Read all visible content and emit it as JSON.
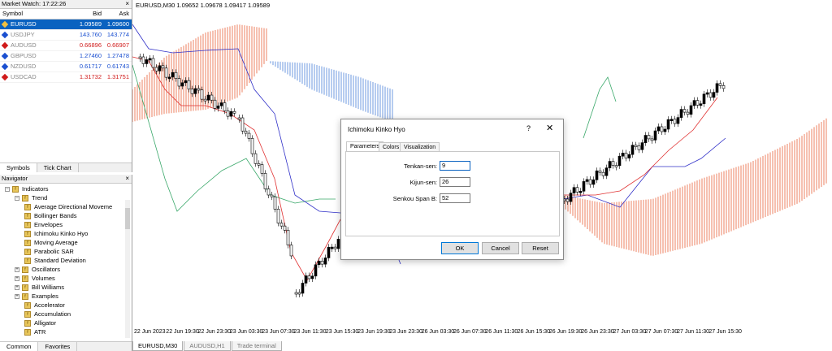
{
  "market_watch": {
    "title": "Market Watch: 17:22:26",
    "columns": {
      "symbol": "Symbol",
      "bid": "Bid",
      "ask": "Ask"
    },
    "rows": [
      {
        "symbol": "EURUSD",
        "bid": "1.09589",
        "ask": "1.09600",
        "color": "#ffffff",
        "selected": true
      },
      {
        "symbol": "USDJPY",
        "bid": "143.760",
        "ask": "143.774",
        "color": "#1a4fd0"
      },
      {
        "symbol": "AUDUSD",
        "bid": "0.66896",
        "ask": "0.66907",
        "color": "#d01a1a"
      },
      {
        "symbol": "GBPUSD",
        "bid": "1.27460",
        "ask": "1.27478",
        "color": "#1a4fd0"
      },
      {
        "symbol": "NZDUSD",
        "bid": "0.61717",
        "ask": "0.61743",
        "color": "#1a4fd0"
      },
      {
        "symbol": "USDCAD",
        "bid": "1.31732",
        "ask": "1.31751",
        "color": "#d01a1a"
      }
    ],
    "tabs": [
      "Symbols",
      "Tick Chart"
    ]
  },
  "navigator": {
    "title": "Navigator",
    "items": [
      {
        "label": "Indicators"
      },
      {
        "label": "Trend"
      },
      {
        "label": "Average Directional Moveme"
      },
      {
        "label": "Bollinger Bands"
      },
      {
        "label": "Envelopes"
      },
      {
        "label": "Ichimoku Kinko Hyo"
      },
      {
        "label": "Moving Average"
      },
      {
        "label": "Parabolic SAR"
      },
      {
        "label": "Standard Deviation"
      },
      {
        "label": "Oscillators"
      },
      {
        "label": "Volumes"
      },
      {
        "label": "Bill Williams"
      },
      {
        "label": "Examples"
      },
      {
        "label": "Accelerator"
      },
      {
        "label": "Accumulation"
      },
      {
        "label": "Alligator"
      },
      {
        "label": "ATR"
      }
    ],
    "tabs": [
      "Common",
      "Favorites"
    ]
  },
  "chart": {
    "title": "EURUSD,M30  1.09652 1.09678 1.09417 1.09589",
    "x_ticks": [
      "22 Jun 2023",
      "22 Jun 19:30",
      "22 Jun 23:30",
      "23 Jun 03:30",
      "23 Jun 07:30",
      "23 Jun 11:30",
      "23 Jun 15:30",
      "23 Jun 19:30",
      "23 Jun 23:30",
      "26 Jun 03:30",
      "26 Jun 07:30",
      "26 Jun 11:30",
      "26 Jun 15:30",
      "26 Jun 19:30",
      "26 Jun 23:30",
      "27 Jun 03:30",
      "27 Jun 07:30",
      "27 Jun 11:30",
      "27 Jun 15:30"
    ],
    "tabs": [
      "EURUSD,M30",
      "AUDUSD,H1",
      "Trade terminal"
    ]
  },
  "dialog": {
    "title": "Ichimoku Kinko Hyo",
    "help": "?",
    "close": "✕",
    "tabs": [
      "Parameters",
      "Colors",
      "Visualization"
    ],
    "fields": [
      {
        "label": "Tenkan-sen:",
        "value": "9"
      },
      {
        "label": "Kijun-sen:",
        "value": "26"
      },
      {
        "label": "Senkou Span B:",
        "value": "52"
      }
    ],
    "buttons": {
      "ok": "OK",
      "cancel": "Cancel",
      "reset": "Reset"
    }
  }
}
